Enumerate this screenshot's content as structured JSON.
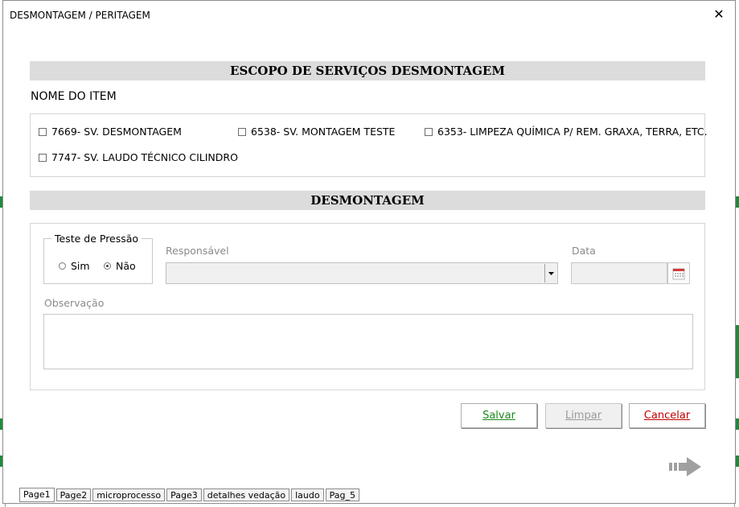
{
  "window": {
    "title": "DESMONTAGEM / PERITAGEM",
    "close_glyph": "✕"
  },
  "escopo": {
    "header": "ESCOPO DE SERVIÇOS DESMONTAGEM",
    "item_label": "NOME DO ITEM",
    "items": [
      {
        "label": "7669- SV. DESMONTAGEM",
        "checked": false
      },
      {
        "label": "6538- SV. MONTAGEM TESTE",
        "checked": false
      },
      {
        "label": "6353- LIMPEZA QUÍMICA P/ REM. GRAXA, TERRA, ETC.",
        "checked": false
      },
      {
        "label": "7747- SV. LAUDO TÉCNICO CILINDRO",
        "checked": false
      }
    ]
  },
  "desmontagem": {
    "header": "DESMONTAGEM",
    "teste_pressao": {
      "legend": "Teste de Pressão",
      "options": [
        {
          "label": "Sim",
          "selected": false
        },
        {
          "label": "Não",
          "selected": true
        }
      ]
    },
    "responsavel_label": "Responsável",
    "responsavel_value": "",
    "data_label": "Data",
    "data_value": "",
    "observacao_label": "Observação",
    "observacao_value": ""
  },
  "buttons": {
    "save": "Salvar",
    "clear": "Limpar",
    "cancel": "Cancelar"
  },
  "colors": {
    "save": "#1a8a1a",
    "clear_disabled": "#9a9a9a",
    "cancel": "#c00000",
    "section_bg": "#dcdcdc"
  },
  "icons": {
    "calendar": "calendar-icon",
    "next": "arrow-right-icon",
    "dropdown": "chevron-down-icon"
  },
  "tabs": [
    {
      "label": "Page1",
      "active": true
    },
    {
      "label": "Page2",
      "active": false
    },
    {
      "label": "microprocesso",
      "active": false
    },
    {
      "label": "Page3",
      "active": false
    },
    {
      "label": "detalhes vedação",
      "active": false
    },
    {
      "label": "laudo",
      "active": false
    },
    {
      "label": "Pag_5",
      "active": false
    }
  ]
}
